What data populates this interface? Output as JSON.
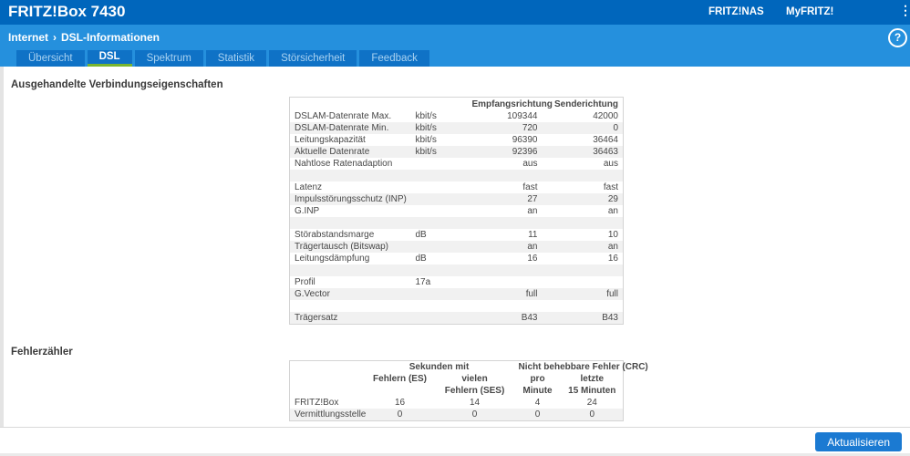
{
  "header": {
    "title": "FRITZ!Box 7430",
    "links": [
      "FRITZ!NAS",
      "MyFRITZ!"
    ],
    "menu_icon": "⋮"
  },
  "breadcrumb": {
    "section": "Internet",
    "separator": "›",
    "page": "DSL-Informationen"
  },
  "help": {
    "symbol": "?"
  },
  "tabs": [
    {
      "label": "Übersicht",
      "active": false
    },
    {
      "label": "DSL",
      "active": true
    },
    {
      "label": "Spektrum",
      "active": false
    },
    {
      "label": "Statistik",
      "active": false
    },
    {
      "label": "Störsicherheit",
      "active": false
    },
    {
      "label": "Feedback",
      "active": false
    }
  ],
  "colors": {
    "topbar_blue": "#0066bc",
    "subheader_blue": "#2590dd",
    "tab_blue": "#0f72c6",
    "active_tab_underline_green": "#79b530",
    "button_blue": "#1b7ad2",
    "stripe_gray": "#f1f1f1"
  },
  "sections": {
    "connection": {
      "title": "Ausgehandelte Verbindungseigenschaften",
      "table": {
        "col_headers": [
          "Empfangsrichtung",
          "Senderichtung"
        ],
        "rows": [
          [
            "DSLAM-Datenrate Max.",
            "kbit/s",
            "109344",
            "42000"
          ],
          [
            "DSLAM-Datenrate Min.",
            "kbit/s",
            "720",
            "0"
          ],
          [
            "Leitungskapazität",
            "kbit/s",
            "96390",
            "36464"
          ],
          [
            "Aktuelle Datenrate",
            "kbit/s",
            "92396",
            "36463"
          ],
          [
            "Nahtlose Ratenadaption",
            "",
            "aus",
            "aus"
          ],
          [
            "",
            "",
            "",
            ""
          ],
          [
            "Latenz",
            "",
            "fast",
            "fast"
          ],
          [
            "Impulsstörungsschutz (INP)",
            "",
            "27",
            "29"
          ],
          [
            "G.INP",
            "",
            "an",
            "an"
          ],
          [
            "",
            "",
            "",
            ""
          ],
          [
            "Störabstandsmarge",
            "dB",
            "11",
            "10"
          ],
          [
            "Trägertausch (Bitswap)",
            "",
            "an",
            "an"
          ],
          [
            "Leitungsdämpfung",
            "dB",
            "16",
            "16"
          ],
          [
            "",
            "",
            "",
            ""
          ],
          [
            "Profil",
            "17a",
            "",
            ""
          ],
          [
            "G.Vector",
            "",
            "full",
            "full"
          ],
          [
            "",
            "",
            "",
            ""
          ],
          [
            "Trägersatz",
            "",
            "B43",
            "B43"
          ]
        ]
      }
    },
    "errors": {
      "title": "Fehlerzähler",
      "table": {
        "group_headers": [
          "Sekunden mit",
          "Nicht behebbare Fehler (CRC)"
        ],
        "col_headers": [
          "Fehlern (ES)",
          "vielen\nFehlern (SES)",
          "pro\nMinute",
          "letzte\n15 Minuten"
        ],
        "rows": [
          [
            "FRITZ!Box",
            "16",
            "14",
            "4",
            "24"
          ],
          [
            "Vermittlungsstelle",
            "0",
            "0",
            "0",
            "0"
          ]
        ]
      }
    }
  },
  "footer": {
    "refresh_label": "Aktualisieren"
  }
}
